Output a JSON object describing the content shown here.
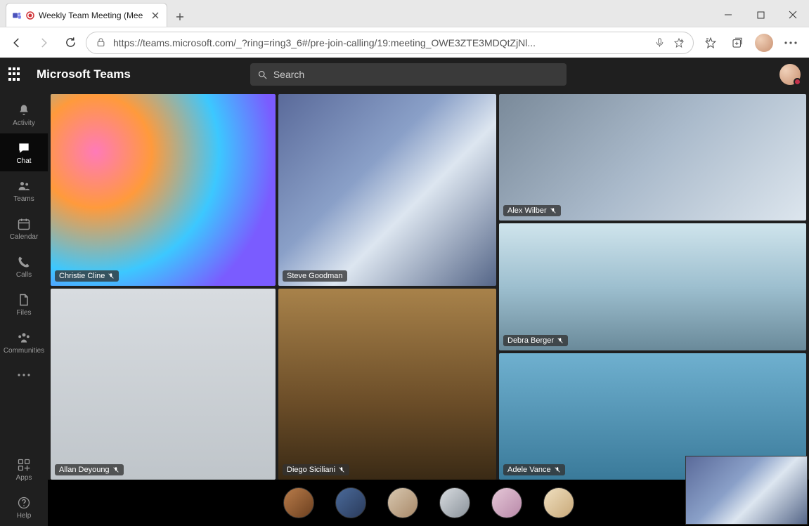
{
  "browser": {
    "tab_title": "Weekly Team Meeting (Mee",
    "url": "https://teams.microsoft.com/_?ring=ring3_6#/pre-join-calling/19:meeting_OWE3ZTE3MDQtZjNl..."
  },
  "teams": {
    "app_title": "Microsoft Teams",
    "search_placeholder": "Search"
  },
  "rail": {
    "activity": "Activity",
    "chat": "Chat",
    "teams": "Teams",
    "calendar": "Calendar",
    "calls": "Calls",
    "files": "Files",
    "communities": "Communities",
    "apps": "Apps",
    "help": "Help"
  },
  "participants": {
    "large": [
      {
        "name": "Christie Cline",
        "muted": true
      },
      {
        "name": "Steve Goodman",
        "muted": false
      },
      {
        "name": "Allan Deyoung",
        "muted": true
      },
      {
        "name": "Diego Siciliani",
        "muted": true
      }
    ],
    "right": [
      {
        "name": "Alex Wilber",
        "muted": true
      },
      {
        "name": "Debra Berger",
        "muted": true
      },
      {
        "name": "Adele Vance",
        "muted": true
      }
    ],
    "overflow_count": 6
  }
}
